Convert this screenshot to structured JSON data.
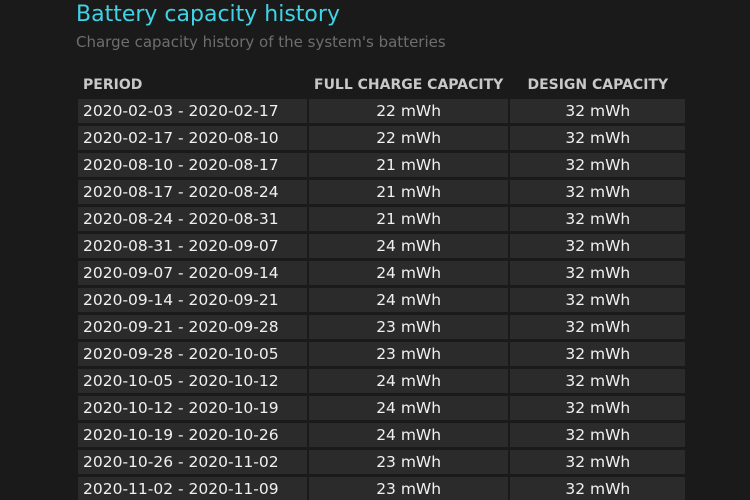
{
  "header": {
    "title": "Battery capacity history",
    "subtitle": "Charge capacity history of the system's batteries"
  },
  "table": {
    "columns": [
      "PERIOD",
      "FULL CHARGE CAPACITY",
      "DESIGN CAPACITY"
    ],
    "rows": [
      {
        "period": "2020-02-03 - 2020-02-17",
        "full": "22 mWh",
        "design": "32 mWh"
      },
      {
        "period": "2020-02-17 - 2020-08-10",
        "full": "22 mWh",
        "design": "32 mWh"
      },
      {
        "period": "2020-08-10 - 2020-08-17",
        "full": "21 mWh",
        "design": "32 mWh"
      },
      {
        "period": "2020-08-17 - 2020-08-24",
        "full": "21 mWh",
        "design": "32 mWh"
      },
      {
        "period": "2020-08-24 - 2020-08-31",
        "full": "21 mWh",
        "design": "32 mWh"
      },
      {
        "period": "2020-08-31 - 2020-09-07",
        "full": "24 mWh",
        "design": "32 mWh"
      },
      {
        "period": "2020-09-07 - 2020-09-14",
        "full": "24 mWh",
        "design": "32 mWh"
      },
      {
        "period": "2020-09-14 - 2020-09-21",
        "full": "24 mWh",
        "design": "32 mWh"
      },
      {
        "period": "2020-09-21 - 2020-09-28",
        "full": "23 mWh",
        "design": "32 mWh"
      },
      {
        "period": "2020-09-28 - 2020-10-05",
        "full": "23 mWh",
        "design": "32 mWh"
      },
      {
        "period": "2020-10-05 - 2020-10-12",
        "full": "24 mWh",
        "design": "32 mWh"
      },
      {
        "period": "2020-10-12 - 2020-10-19",
        "full": "24 mWh",
        "design": "32 mWh"
      },
      {
        "period": "2020-10-19 - 2020-10-26",
        "full": "24 mWh",
        "design": "32 mWh"
      },
      {
        "period": "2020-10-26 - 2020-11-02",
        "full": "23 mWh",
        "design": "32 mWh"
      },
      {
        "period": "2020-11-02 - 2020-11-09",
        "full": "23 mWh",
        "design": "32 mWh"
      }
    ]
  }
}
